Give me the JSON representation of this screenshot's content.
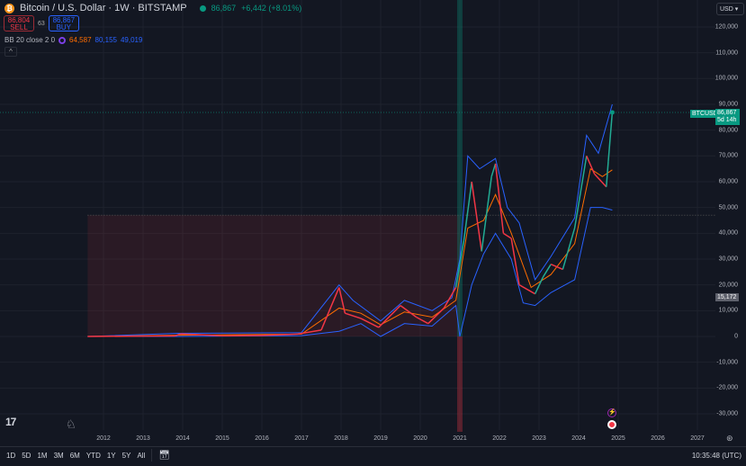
{
  "header": {
    "symbol": "Bitcoin / U.S. Dollar · 1W · BITSTAMP",
    "last": "86,867",
    "change": "+6,442 (+8.01%)"
  },
  "trade": {
    "sell_price": "86,804",
    "sell_label": "SELL",
    "spread": "63",
    "buy_price": "86,867",
    "buy_label": "BUY"
  },
  "indicator": {
    "label": "BB 20 close 2 0",
    "basis": "64,587",
    "upper": "80,155",
    "lower": "49,019",
    "colors": {
      "basis": "#ff6d00",
      "bands": "#2962ff"
    }
  },
  "currency": "USD",
  "price_tag": {
    "symbol": "BTCUSD",
    "price": "86,867",
    "countdown": "5d 14h"
  },
  "cursor_tag": "15,172",
  "range_buttons": [
    "1D",
    "5D",
    "1M",
    "3M",
    "6M",
    "YTD",
    "1Y",
    "5Y",
    "All"
  ],
  "clock": "10:35:48 (UTC)",
  "colors": {
    "up": "#089981",
    "down": "#f23645",
    "background": "#131722"
  },
  "chart_data": {
    "type": "line",
    "yticks": [
      "120,000",
      "110,000",
      "100,000",
      "90,000",
      "80,000",
      "70,000",
      "60,000",
      "50,000",
      "40,000",
      "30,000",
      "20,000",
      "10,000",
      "0",
      "-10,000",
      "-20,000",
      "-30,000"
    ],
    "xticks": [
      "2012",
      "2013",
      "2014",
      "2015",
      "2016",
      "2017",
      "2018",
      "2019",
      "2020",
      "2021",
      "2022",
      "2023",
      "2024",
      "2025",
      "2026",
      "2027"
    ],
    "ylim": [
      -37000,
      130000
    ],
    "price": {
      "x": [
        2011.6,
        2013.8,
        2013.95,
        2014.5,
        2015.0,
        2016.0,
        2016.9,
        2017.5,
        2017.95,
        2018.1,
        2018.5,
        2018.95,
        2019.5,
        2019.9,
        2020.2,
        2020.6,
        2020.9,
        2021.1,
        2021.3,
        2021.55,
        2021.8,
        2021.9,
        2022.1,
        2022.3,
        2022.5,
        2022.9,
        2023.1,
        2023.3,
        2023.6,
        2023.9,
        2024.2,
        2024.4,
        2024.7,
        2024.75,
        2024.85
      ],
      "y": [
        5,
        200,
        1000,
        600,
        250,
        400,
        900,
        2500,
        19000,
        9000,
        7000,
        3500,
        12000,
        7500,
        5000,
        11000,
        19000,
        37000,
        60000,
        33000,
        62000,
        67000,
        40000,
        38000,
        20000,
        16500,
        23000,
        28000,
        26000,
        42000,
        70000,
        63000,
        58000,
        68000,
        86867
      ]
    },
    "bb_upper": {
      "x": [
        2011.6,
        2013.9,
        2017.0,
        2017.95,
        2018.3,
        2019.0,
        2019.6,
        2020.3,
        2020.8,
        2021.0,
        2021.2,
        2021.5,
        2021.9,
        2022.2,
        2022.5,
        2022.9,
        2023.3,
        2023.9,
        2024.2,
        2024.5,
        2024.85
      ],
      "y": [
        10,
        1200,
        1500,
        20000,
        14000,
        6000,
        14000,
        10000,
        15000,
        30000,
        70000,
        65000,
        69000,
        50000,
        44000,
        22000,
        31000,
        46000,
        78000,
        71000,
        90000
      ]
    },
    "bb_basis": {
      "x": [
        2011.6,
        2013.9,
        2017.0,
        2017.95,
        2018.5,
        2019.0,
        2019.6,
        2020.3,
        2020.9,
        2021.2,
        2021.6,
        2021.9,
        2022.3,
        2022.8,
        2023.3,
        2023.9,
        2024.3,
        2024.6,
        2024.85
      ],
      "y": [
        5,
        500,
        900,
        11000,
        9000,
        4500,
        9500,
        7500,
        14000,
        42000,
        45000,
        55000,
        40000,
        19000,
        24000,
        36000,
        65000,
        62000,
        64587
      ]
    },
    "bb_lower": {
      "x": [
        2011.6,
        2013.9,
        2017.0,
        2017.95,
        2018.5,
        2019.0,
        2019.6,
        2020.3,
        2020.9,
        2021.0,
        2021.3,
        2021.6,
        2021.9,
        2022.3,
        2022.6,
        2022.9,
        2023.3,
        2023.9,
        2024.3,
        2024.6,
        2024.85
      ],
      "y": [
        0,
        0,
        300,
        2000,
        5000,
        0,
        5000,
        4000,
        12000,
        0,
        20000,
        32000,
        40000,
        30000,
        13000,
        12000,
        17000,
        22000,
        50000,
        50000,
        49019
      ]
    },
    "range_box": {
      "x": [
        2011.6,
        2021.0
      ],
      "y": [
        0,
        47000
      ]
    },
    "highlight_x": 2021.0
  }
}
